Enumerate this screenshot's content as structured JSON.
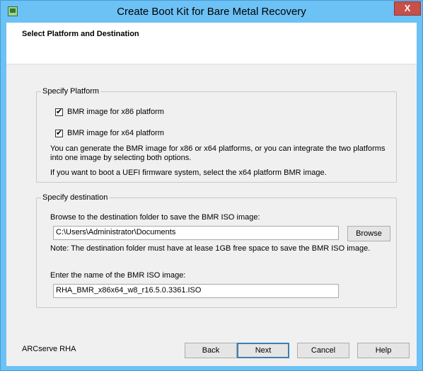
{
  "window": {
    "title": "Create Boot Kit for Bare Metal Recovery",
    "close_label": "X"
  },
  "header": {
    "title": "Select Platform and Destination"
  },
  "platform": {
    "legend": "Specify Platform",
    "x86_label": "BMR image for x86 platform",
    "x86_checked": true,
    "x64_label": "BMR image for x64 platform",
    "x64_checked": true,
    "info_line1": "You can generate the BMR image for x86 or x64 platforms, or you can integrate the two platforms",
    "info_line2": "into one image by selecting both options.",
    "uefi_note": "If you want to boot a UEFI firmware system, select the x64 platform BMR image."
  },
  "destination": {
    "legend": "Specify destination",
    "browse_label": "Browse to the destination folder to save the BMR ISO image:",
    "folder_value": "C:\\Users\\Administrator\\Documents",
    "browse_button": "Browse",
    "note": "Note: The destination folder must have at lease 1GB free space to save the BMR ISO image.",
    "name_label": "Enter the name of the BMR ISO image:",
    "name_value": "RHA_BMR_x86x64_w8_r16.5.0.3361.ISO"
  },
  "footer": {
    "brand": "ARCserve RHA",
    "back": "Back",
    "next": "Next",
    "cancel": "Cancel",
    "help": "Help"
  }
}
